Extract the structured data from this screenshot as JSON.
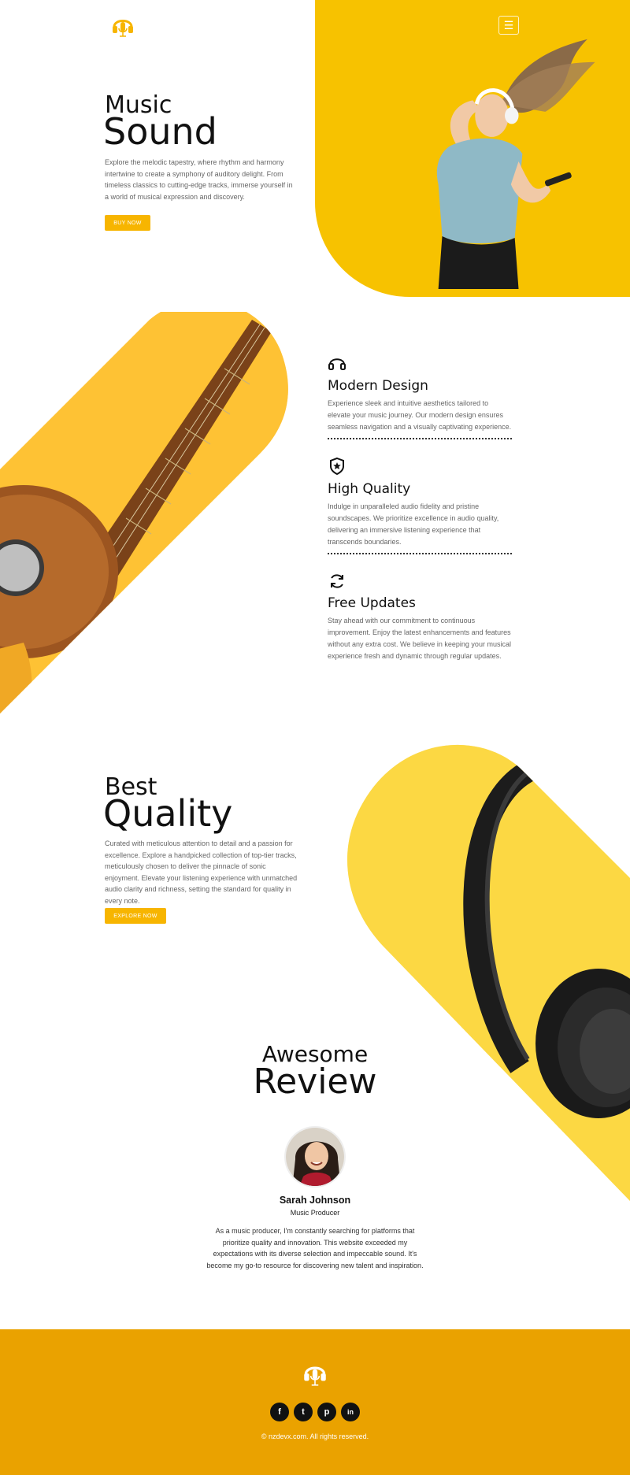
{
  "colors": {
    "accent": "#f7c200",
    "button": "#f7b500",
    "footer": "#eaa200"
  },
  "hero": {
    "title_small": "Music",
    "title_big": "Sound",
    "description": "Explore the melodic tapestry, where rhythm and harmony intertwine to create a symphony of auditory delight. From timeless classics to cutting-edge tracks, immerse yourself in a world of musical expression and discovery.",
    "button": "BUY NOW",
    "menu_icon": "hamburger-icon",
    "menu_glyph": "☰"
  },
  "features": [
    {
      "icon": "headphones-icon",
      "title": "Modern Design",
      "text": "Experience sleek and intuitive aesthetics tailored to elevate your music journey. Our modern design ensures seamless navigation and a visually captivating experience."
    },
    {
      "icon": "shield-star-icon",
      "title": "High Quality",
      "text": "Indulge in unparalleled audio fidelity and pristine soundscapes. We prioritize excellence in audio quality, delivering an immersive listening experience that transcends boundaries."
    },
    {
      "icon": "refresh-icon",
      "title": "Free Updates",
      "text": "Stay ahead with our commitment to continuous improvement. Enjoy the latest enhancements and features without any extra cost. We believe in keeping your musical experience fresh and dynamic through regular updates."
    }
  ],
  "quality": {
    "title_small": "Best",
    "title_big": "Quality",
    "description": "Curated with meticulous attention to detail and a passion for excellence. Explore a handpicked collection of top-tier tracks, meticulously chosen to deliver the pinnacle of sonic enjoyment. Elevate your listening experience with unmatched audio clarity and richness, setting the standard for quality in every note.",
    "button": "EXPLORE NOW"
  },
  "review": {
    "title_small": "Awesome",
    "title_big": "Review",
    "name": "Sarah Johnson",
    "role": "Music Producer",
    "text": "As a music producer, I'm constantly searching for platforms that prioritize quality and innovation. This website exceeded my expectations with its diverse selection and impeccable sound. It's become my go-to resource for discovering new talent and inspiration."
  },
  "footer": {
    "social": [
      {
        "icon": "facebook-icon",
        "glyph": "f"
      },
      {
        "icon": "twitter-icon",
        "glyph": "t"
      },
      {
        "icon": "pinterest-icon",
        "glyph": "p"
      },
      {
        "icon": "linkedin-icon",
        "glyph": "in"
      }
    ],
    "copyright": "© nzdevx.com. All rights reserved."
  }
}
